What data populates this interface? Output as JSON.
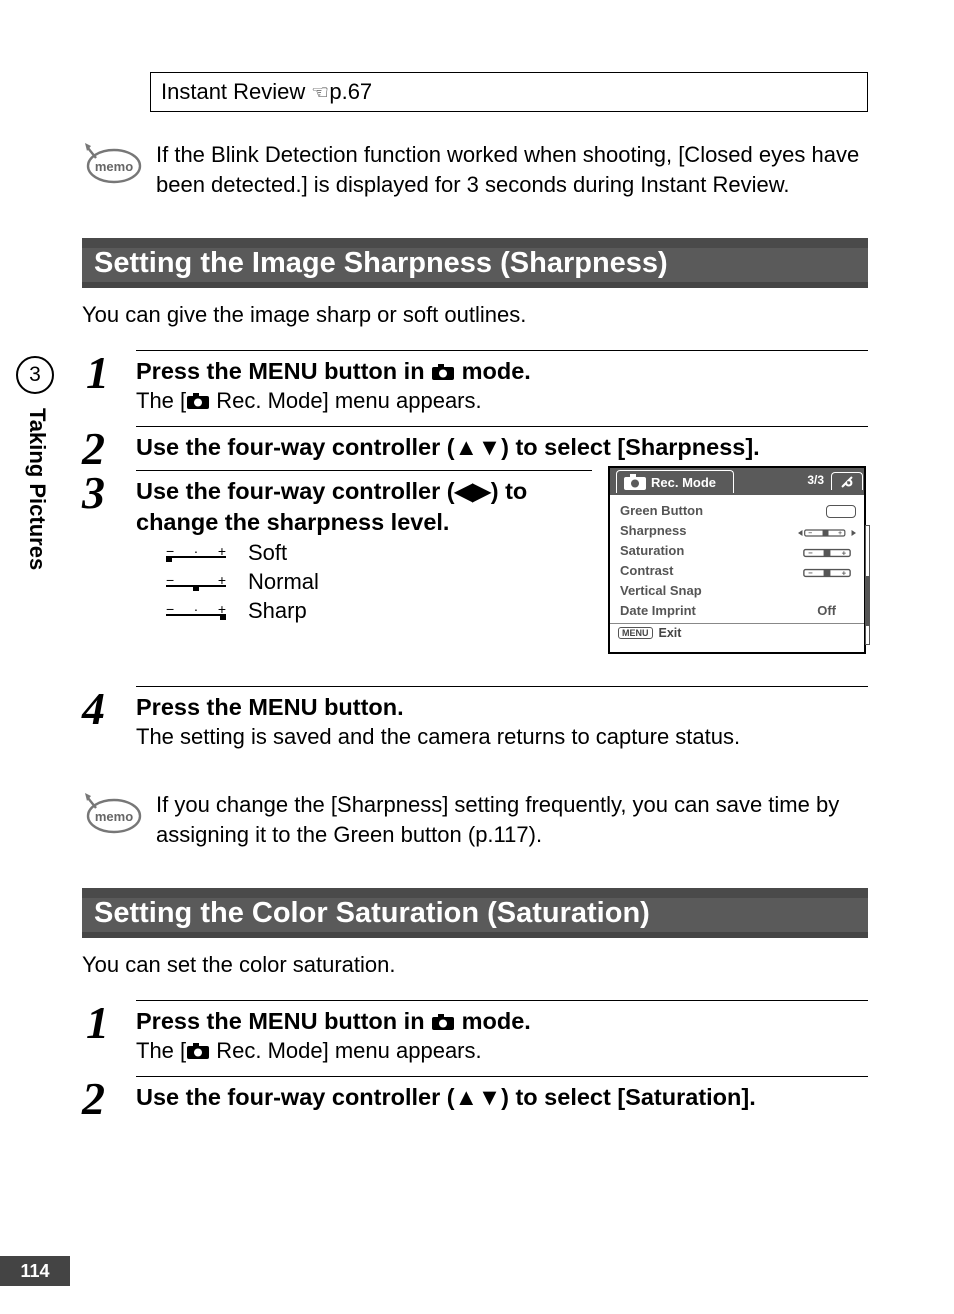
{
  "page_number": "114",
  "top_box": {
    "text": "Instant Review ",
    "ref": "p.67"
  },
  "memo1": "If the Blink Detection function worked when shooting, [Closed eyes have been detected.] is displayed for 3 seconds during Instant Review.",
  "side": {
    "chapter": "3",
    "label": "Taking Pictures"
  },
  "sectionA": {
    "title": "Setting the Image Sharpness (Sharpness)",
    "intro": "You can give the image sharp or soft outlines.",
    "steps": {
      "s1": {
        "n": "1",
        "title_pre": "Press the ",
        "menu": "MENU",
        "title_mid": " button in ",
        "title_post": " mode.",
        "body_pre": "The [",
        "body_post": " Rec. Mode] menu appears."
      },
      "s2": {
        "n": "2",
        "title": "Use the four-way controller (▲▼) to select [Sharpness]."
      },
      "s3": {
        "n": "3",
        "title": "Use the four-way controller (◀▶) to change the sharpness level.",
        "levels": {
          "soft": "Soft",
          "normal": "Normal",
          "sharp": "Sharp"
        }
      },
      "s4": {
        "n": "4",
        "title_pre": "Press the ",
        "menu": "MENU",
        "title_post": " button.",
        "body": "The setting is saved and the camera returns to capture status."
      }
    }
  },
  "memo2": "If you change the [Sharpness] setting frequently, you can save time by assigning it to the Green button (p.117).",
  "sectionB": {
    "title": "Setting the Color Saturation (Saturation)",
    "intro": "You can set the color saturation.",
    "steps": {
      "s1": {
        "n": "1",
        "title_pre": "Press the ",
        "menu": "MENU",
        "title_mid": " button in ",
        "title_post": " mode.",
        "body_pre": "The [",
        "body_post": " Rec. Mode] menu appears."
      },
      "s2": {
        "n": "2",
        "title": "Use the four-way controller (▲▼) to select [Saturation]."
      }
    }
  },
  "lcd": {
    "title": "Rec. Mode",
    "page": "3/3",
    "rows": {
      "green": "Green Button",
      "sharp": "Sharpness",
      "sat": "Saturation",
      "cont": "Contrast",
      "vsnap": "Vertical Snap",
      "date": "Date Imprint",
      "date_val": "Off"
    },
    "footer": {
      "menu": "MENU",
      "exit": "Exit"
    }
  }
}
